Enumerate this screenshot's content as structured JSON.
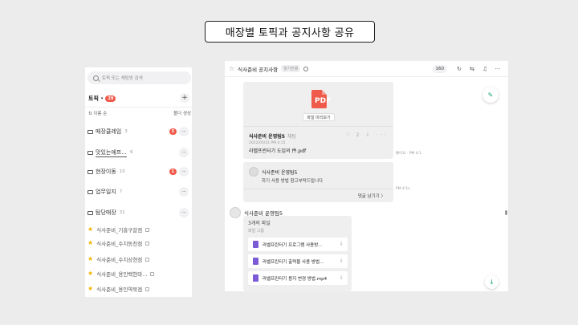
{
  "slide_title": "매장별 토픽과 공지사항 공유",
  "left_panel": {
    "search_placeholder": "토픽 또는 채팅방 검색",
    "topic_label": "토픽",
    "topic_caret": "▾",
    "topic_badge": "29",
    "add_icon": "+",
    "sort_label": "이름 순",
    "sort_icon": "⇅",
    "folder_action": "폴더 생성",
    "folders": [
      {
        "name": "매장클레임",
        "count": "3",
        "badge": "3"
      },
      {
        "name": "맛있는에프...",
        "count": "9",
        "badge": ""
      },
      {
        "name": "현장이동",
        "count": "10",
        "badge": "1"
      },
      {
        "name": "업무일지",
        "count": "7",
        "badge": ""
      },
      {
        "name": "탐당매장",
        "count": "31",
        "badge": ""
      }
    ],
    "more_icon": "···",
    "channels": [
      {
        "name": "식사준비_기흥구갈점"
      },
      {
        "name": "식사준비_수지동천점"
      },
      {
        "name": "식사준비_수지상현점"
      },
      {
        "name": "식사준비_용인백현마..."
      },
      {
        "name": "식사준비_용인역북점"
      }
    ],
    "star_icon": "★"
  },
  "right_panel": {
    "header": {
      "star_icon": "☆",
      "title": "식사준비 공지사항",
      "tag": "읽기전용",
      "member_count": "160",
      "icons": [
        "↻",
        "⇆",
        "♫",
        "···"
      ]
    },
    "pdf_message": {
      "pdf_label": "PDF",
      "preview_button": "파일 미리보기",
      "sender": "식사준비 운영팀5",
      "sender_sub": "채팅",
      "meta": "2022/05/21 PM 4:15",
      "file_name": "라벨프린터기 도입의 件.pdf",
      "actions": "♡ 2 ⇩ ···",
      "side_meta": "좋아요 · PM 4:1"
    },
    "reply": {
      "name": "식사준비 운영팀5",
      "text": "하기 사용 방법 참고부탁드립니다",
      "more": "댓글 남기기 〉",
      "side_meta": "PM 4:1x"
    },
    "files_message": {
      "sender": "식사준비 운영팀5",
      "count_text": "3개의 파일",
      "sub_text": "파일 그룹",
      "files": [
        {
          "name": "라벨프린터기 프로그램 사용방..."
        },
        {
          "name": "라벨프린터기 출력물 사용 방법..."
        },
        {
          "name": "라벨프린터기 용지 변경 방법.mp4"
        }
      ],
      "download_icon": "⇩"
    },
    "fab_top_icon": "✎",
    "fab_down_icon": "↓"
  }
}
